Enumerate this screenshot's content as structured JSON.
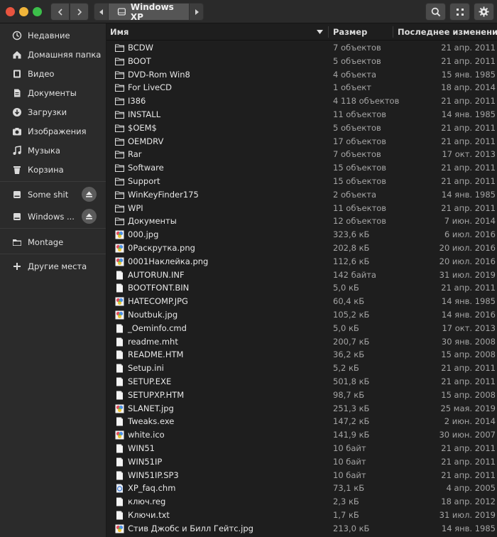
{
  "window": {
    "current_location": "Windows XP"
  },
  "sidebar": {
    "places": [
      {
        "label": "Недавние",
        "icon": "clock-icon"
      },
      {
        "label": "Домашняя папка",
        "icon": "home-icon"
      },
      {
        "label": "Видео",
        "icon": "video-icon"
      },
      {
        "label": "Документы",
        "icon": "document-icon"
      },
      {
        "label": "Загрузки",
        "icon": "download-icon"
      },
      {
        "label": "Изображения",
        "icon": "camera-icon"
      },
      {
        "label": "Музыка",
        "icon": "music-icon"
      },
      {
        "label": "Корзина",
        "icon": "trash-icon"
      }
    ],
    "devices": [
      {
        "label": "Some shit",
        "icon": "drive-icon"
      },
      {
        "label": "Windows ...",
        "icon": "drive-icon"
      }
    ],
    "network": [
      {
        "label": "Montage",
        "icon": "folder-icon"
      }
    ],
    "other_places": {
      "label": "Другие места",
      "icon": "plus-icon"
    }
  },
  "columns": {
    "name": "Имя",
    "size": "Размер",
    "modified": "Последнее изменение"
  },
  "files": [
    {
      "name": "BCDW",
      "size": "7 объектов",
      "date": "21 апр. 2011",
      "type": "folder"
    },
    {
      "name": "BOOT",
      "size": "5 объектов",
      "date": "21 апр. 2011",
      "type": "folder"
    },
    {
      "name": "DVD-Rom Win8",
      "size": "4 объекта",
      "date": "15 янв. 1985",
      "type": "folder"
    },
    {
      "name": "For LiveCD",
      "size": "1 объект",
      "date": "18 апр. 2014",
      "type": "folder"
    },
    {
      "name": "I386",
      "size": "4 118 объектов",
      "date": "21 апр. 2011",
      "type": "folder"
    },
    {
      "name": "INSTALL",
      "size": "11 объектов",
      "date": "14 янв. 1985",
      "type": "folder"
    },
    {
      "name": "$OEM$",
      "size": "5 объектов",
      "date": "21 апр. 2011",
      "type": "folder"
    },
    {
      "name": "OEMDRV",
      "size": "17 объектов",
      "date": "21 апр. 2011",
      "type": "folder"
    },
    {
      "name": "Rar",
      "size": "7 объектов",
      "date": "17 окт. 2013",
      "type": "folder"
    },
    {
      "name": "Software",
      "size": "15 объектов",
      "date": "21 апр. 2011",
      "type": "folder"
    },
    {
      "name": "Support",
      "size": "15 объектов",
      "date": "21 апр. 2011",
      "type": "folder"
    },
    {
      "name": "WinKeyFinder175",
      "size": "2 объекта",
      "date": "14 янв. 1985",
      "type": "folder"
    },
    {
      "name": "WPI",
      "size": "11 объектов",
      "date": "21 апр. 2011",
      "type": "folder"
    },
    {
      "name": "Документы",
      "size": "12 объектов",
      "date": "7 июн. 2014",
      "type": "folder"
    },
    {
      "name": "000.jpg",
      "size": "323,6 кБ",
      "date": "6 июл. 2016",
      "type": "image"
    },
    {
      "name": "0Раскрутка.png",
      "size": "202,8 кБ",
      "date": "20 июл. 2016",
      "type": "image"
    },
    {
      "name": "0001Наклейка.png",
      "size": "112,6 кБ",
      "date": "20 июл. 2016",
      "type": "image"
    },
    {
      "name": "AUTORUN.INF",
      "size": "142 байта",
      "date": "31 июл. 2019",
      "type": "file"
    },
    {
      "name": "BOOTFONT.BIN",
      "size": "5,0 кБ",
      "date": "21 апр. 2011",
      "type": "file"
    },
    {
      "name": "HATECOMP.JPG",
      "size": "60,4 кБ",
      "date": "14 янв. 1985",
      "type": "image"
    },
    {
      "name": "Noutbuk.jpg",
      "size": "105,2 кБ",
      "date": "14 янв. 2016",
      "type": "image"
    },
    {
      "name": "_Oeminfo.cmd",
      "size": "5,0 кБ",
      "date": "17 окт. 2013",
      "type": "file"
    },
    {
      "name": "readme.mht",
      "size": "200,7 кБ",
      "date": "30 янв. 2008",
      "type": "file"
    },
    {
      "name": "README.HTM",
      "size": "36,2 кБ",
      "date": "15 апр. 2008",
      "type": "file"
    },
    {
      "name": "Setup.ini",
      "size": "5,2 кБ",
      "date": "21 апр. 2011",
      "type": "file"
    },
    {
      "name": "SETUP.EXE",
      "size": "501,8 кБ",
      "date": "21 апр. 2011",
      "type": "file"
    },
    {
      "name": "SETUPXP.HTM",
      "size": "98,7 кБ",
      "date": "15 апр. 2008",
      "type": "file"
    },
    {
      "name": "SLANET.jpg",
      "size": "251,3 кБ",
      "date": "25 мая. 2019",
      "type": "image"
    },
    {
      "name": "Tweaks.exe",
      "size": "147,2 кБ",
      "date": "2 июн. 2014",
      "type": "file"
    },
    {
      "name": "white.ico",
      "size": "141,9 кБ",
      "date": "30 июн. 2007",
      "type": "image"
    },
    {
      "name": "WIN51",
      "size": "10 байт",
      "date": "21 апр. 2011",
      "type": "file"
    },
    {
      "name": "WIN51IP",
      "size": "10 байт",
      "date": "21 апр. 2011",
      "type": "file"
    },
    {
      "name": "WIN51IP.SP3",
      "size": "10 байт",
      "date": "21 апр. 2011",
      "type": "file"
    },
    {
      "name": "XP_faq.chm",
      "size": "73,1 кБ",
      "date": "4 апр. 2005",
      "type": "help"
    },
    {
      "name": "ключ.reg",
      "size": "2,3 кБ",
      "date": "18 апр. 2012",
      "type": "file"
    },
    {
      "name": "Ключи.txt",
      "size": "1,7 кБ",
      "date": "31 июл. 2019",
      "type": "file"
    },
    {
      "name": "Стив Джобс и Билл Гейтс.jpg",
      "size": "213,0 кБ",
      "date": "14 янв. 1985",
      "type": "image"
    }
  ]
}
